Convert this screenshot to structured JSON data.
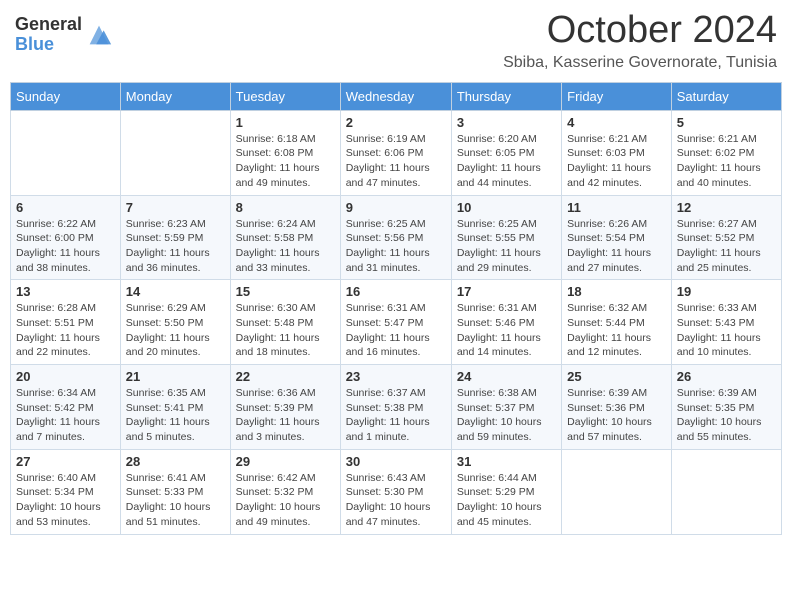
{
  "header": {
    "logo_general": "General",
    "logo_blue": "Blue",
    "month_year": "October 2024",
    "subtitle": "Sbiba, Kasserine Governorate, Tunisia"
  },
  "days_of_week": [
    "Sunday",
    "Monday",
    "Tuesday",
    "Wednesday",
    "Thursday",
    "Friday",
    "Saturday"
  ],
  "weeks": [
    [
      {
        "day": "",
        "info": ""
      },
      {
        "day": "",
        "info": ""
      },
      {
        "day": "1",
        "info": "Sunrise: 6:18 AM\nSunset: 6:08 PM\nDaylight: 11 hours and 49 minutes."
      },
      {
        "day": "2",
        "info": "Sunrise: 6:19 AM\nSunset: 6:06 PM\nDaylight: 11 hours and 47 minutes."
      },
      {
        "day": "3",
        "info": "Sunrise: 6:20 AM\nSunset: 6:05 PM\nDaylight: 11 hours and 44 minutes."
      },
      {
        "day": "4",
        "info": "Sunrise: 6:21 AM\nSunset: 6:03 PM\nDaylight: 11 hours and 42 minutes."
      },
      {
        "day": "5",
        "info": "Sunrise: 6:21 AM\nSunset: 6:02 PM\nDaylight: 11 hours and 40 minutes."
      }
    ],
    [
      {
        "day": "6",
        "info": "Sunrise: 6:22 AM\nSunset: 6:00 PM\nDaylight: 11 hours and 38 minutes."
      },
      {
        "day": "7",
        "info": "Sunrise: 6:23 AM\nSunset: 5:59 PM\nDaylight: 11 hours and 36 minutes."
      },
      {
        "day": "8",
        "info": "Sunrise: 6:24 AM\nSunset: 5:58 PM\nDaylight: 11 hours and 33 minutes."
      },
      {
        "day": "9",
        "info": "Sunrise: 6:25 AM\nSunset: 5:56 PM\nDaylight: 11 hours and 31 minutes."
      },
      {
        "day": "10",
        "info": "Sunrise: 6:25 AM\nSunset: 5:55 PM\nDaylight: 11 hours and 29 minutes."
      },
      {
        "day": "11",
        "info": "Sunrise: 6:26 AM\nSunset: 5:54 PM\nDaylight: 11 hours and 27 minutes."
      },
      {
        "day": "12",
        "info": "Sunrise: 6:27 AM\nSunset: 5:52 PM\nDaylight: 11 hours and 25 minutes."
      }
    ],
    [
      {
        "day": "13",
        "info": "Sunrise: 6:28 AM\nSunset: 5:51 PM\nDaylight: 11 hours and 22 minutes."
      },
      {
        "day": "14",
        "info": "Sunrise: 6:29 AM\nSunset: 5:50 PM\nDaylight: 11 hours and 20 minutes."
      },
      {
        "day": "15",
        "info": "Sunrise: 6:30 AM\nSunset: 5:48 PM\nDaylight: 11 hours and 18 minutes."
      },
      {
        "day": "16",
        "info": "Sunrise: 6:31 AM\nSunset: 5:47 PM\nDaylight: 11 hours and 16 minutes."
      },
      {
        "day": "17",
        "info": "Sunrise: 6:31 AM\nSunset: 5:46 PM\nDaylight: 11 hours and 14 minutes."
      },
      {
        "day": "18",
        "info": "Sunrise: 6:32 AM\nSunset: 5:44 PM\nDaylight: 11 hours and 12 minutes."
      },
      {
        "day": "19",
        "info": "Sunrise: 6:33 AM\nSunset: 5:43 PM\nDaylight: 11 hours and 10 minutes."
      }
    ],
    [
      {
        "day": "20",
        "info": "Sunrise: 6:34 AM\nSunset: 5:42 PM\nDaylight: 11 hours and 7 minutes."
      },
      {
        "day": "21",
        "info": "Sunrise: 6:35 AM\nSunset: 5:41 PM\nDaylight: 11 hours and 5 minutes."
      },
      {
        "day": "22",
        "info": "Sunrise: 6:36 AM\nSunset: 5:39 PM\nDaylight: 11 hours and 3 minutes."
      },
      {
        "day": "23",
        "info": "Sunrise: 6:37 AM\nSunset: 5:38 PM\nDaylight: 11 hours and 1 minute."
      },
      {
        "day": "24",
        "info": "Sunrise: 6:38 AM\nSunset: 5:37 PM\nDaylight: 10 hours and 59 minutes."
      },
      {
        "day": "25",
        "info": "Sunrise: 6:39 AM\nSunset: 5:36 PM\nDaylight: 10 hours and 57 minutes."
      },
      {
        "day": "26",
        "info": "Sunrise: 6:39 AM\nSunset: 5:35 PM\nDaylight: 10 hours and 55 minutes."
      }
    ],
    [
      {
        "day": "27",
        "info": "Sunrise: 6:40 AM\nSunset: 5:34 PM\nDaylight: 10 hours and 53 minutes."
      },
      {
        "day": "28",
        "info": "Sunrise: 6:41 AM\nSunset: 5:33 PM\nDaylight: 10 hours and 51 minutes."
      },
      {
        "day": "29",
        "info": "Sunrise: 6:42 AM\nSunset: 5:32 PM\nDaylight: 10 hours and 49 minutes."
      },
      {
        "day": "30",
        "info": "Sunrise: 6:43 AM\nSunset: 5:30 PM\nDaylight: 10 hours and 47 minutes."
      },
      {
        "day": "31",
        "info": "Sunrise: 6:44 AM\nSunset: 5:29 PM\nDaylight: 10 hours and 45 minutes."
      },
      {
        "day": "",
        "info": ""
      },
      {
        "day": "",
        "info": ""
      }
    ]
  ]
}
